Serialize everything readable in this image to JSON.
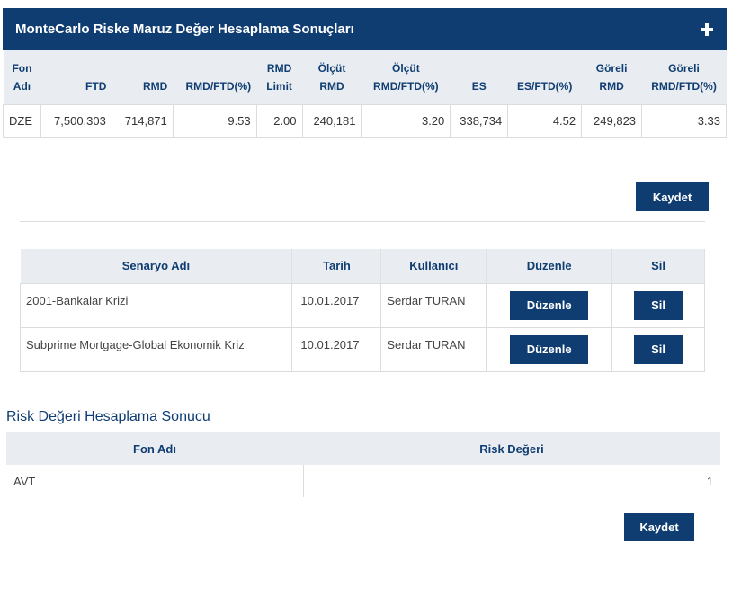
{
  "panel": {
    "title": "MonteCarlo Riske Maruz Değer Hesaplama Sonuçları",
    "expand_icon": "plus-icon"
  },
  "results": {
    "headers": [
      [
        "Fon",
        "Adı"
      ],
      [
        "",
        "FTD"
      ],
      [
        "",
        "RMD"
      ],
      [
        "",
        "RMD/FTD(%)"
      ],
      [
        "RMD",
        "Limit"
      ],
      [
        "Ölçüt",
        "RMD"
      ],
      [
        "Ölçüt",
        "RMD/FTD(%)"
      ],
      [
        "",
        "ES"
      ],
      [
        "",
        "ES/FTD(%)"
      ],
      [
        "Göreli",
        "RMD"
      ],
      [
        "Göreli",
        "RMD/FTD(%)"
      ]
    ],
    "row": [
      "DZE",
      "7,500,303",
      "714,871",
      "9.53",
      "2.00",
      "240,181",
      "3.20",
      "338,734",
      "4.52",
      "249,823",
      "3.33"
    ]
  },
  "save_label": "Kaydet",
  "scenarios": {
    "headers": [
      "Senaryo Adı",
      "Tarih",
      "Kullanıcı",
      "Düzenle",
      "Sil"
    ],
    "rows": [
      {
        "name": "2001-Bankalar Krizi",
        "date": "10.01.2017",
        "user": "Serdar TURAN",
        "edit": "Düzenle",
        "delete": "Sil"
      },
      {
        "name": "Subprime Mortgage-Global Ekonomik Kriz",
        "date": "10.01.2017",
        "user": "Serdar TURAN",
        "edit": "Düzenle",
        "delete": "Sil"
      }
    ]
  },
  "risk": {
    "title": "Risk Değeri Hesaplama Sonucu",
    "headers": [
      "Fon Adı",
      "Risk Değeri"
    ],
    "rows": [
      {
        "fund": "AVT",
        "value": "1"
      }
    ]
  },
  "colors": {
    "primary": "#0f3d72",
    "header_bg": "#e9ecf1"
  }
}
